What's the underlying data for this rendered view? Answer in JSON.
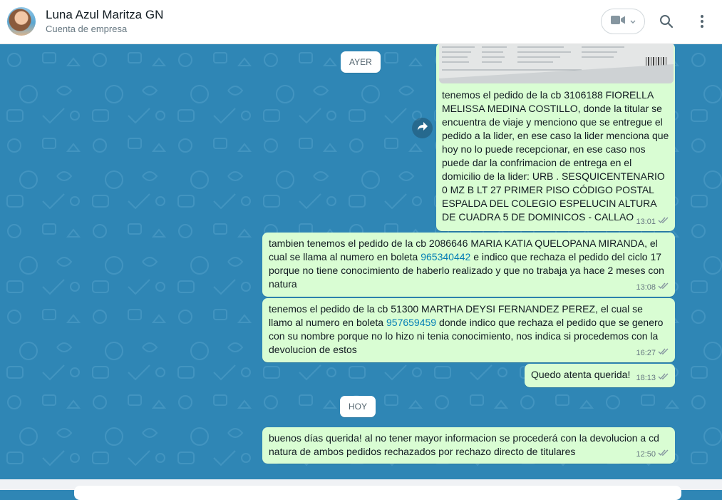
{
  "header": {
    "contact_name": "Luna Azul Maritza GN",
    "contact_subtitle": "Cuenta de empresa",
    "icons": [
      "video-call-icon",
      "search-icon",
      "menu-dots-icon"
    ]
  },
  "chat": {
    "date_yesterday": "AYER",
    "date_today": "HOY",
    "messages": [
      {
        "text": "tenemos el pedido de la cb 3106188 FIORELLA MELISSA MEDINA COSTILLO, donde la titular se encuentra de viaje y menciono que se entregue el pedido a la lider, en ese caso la lider menciona que hoy no lo puede recepcionar, en ese caso nos puede dar la confrimacion de entrega en el domicilio de la lider:  URB . SESQUICENTENARIO 0 MZ B LT 27 PRIMER PISO CÓDIGO POSTAL ESPALDA DEL COLEGIO ESPELUCIN ALTURA DE CUADRA 5 DE DOMINICOS - CALLAO",
        "time": "13:01",
        "status": "read"
      },
      {
        "text_before": "tambien tenemos el pedido de la cb 2086646 MARIA KATIA QUELOPANA MIRANDA, el cual se llama al numero en boleta ",
        "phone": "965340442",
        "text_after": " e indico que rechaza el pedido del ciclo 17 porque no tiene conocimiento de haberlo realizado y que no trabaja ya hace 2 meses con natura",
        "time": "13:08",
        "status": "read"
      },
      {
        "text_before": "tenemos el pedido de la cb 51300 MARTHA DEYSI FERNANDEZ PEREZ, el cual se llamo al numero en boleta ",
        "phone": "957659459",
        "text_after": " donde indico que rechaza el pedido que se genero con su nombre porque no lo hizo ni tenia conocimiento, nos indica si procedemos con la devolucion de estos",
        "time": "16:27",
        "status": "read"
      },
      {
        "text": "Quedo atenta querida!",
        "time": "18:13",
        "status": "read"
      },
      {
        "text": "buenos días querida! al no tener mayor informacion se procederá con la devolucion a cd natura de ambos pedidos rechazados por rechazo directo de titulares",
        "time": "12:50",
        "status": "read"
      }
    ]
  },
  "colors": {
    "chat_background": "#2f86b5",
    "outgoing_bubble": "#d9fdd3",
    "link": "#027eb5",
    "read_ticks": "#8696a0"
  }
}
